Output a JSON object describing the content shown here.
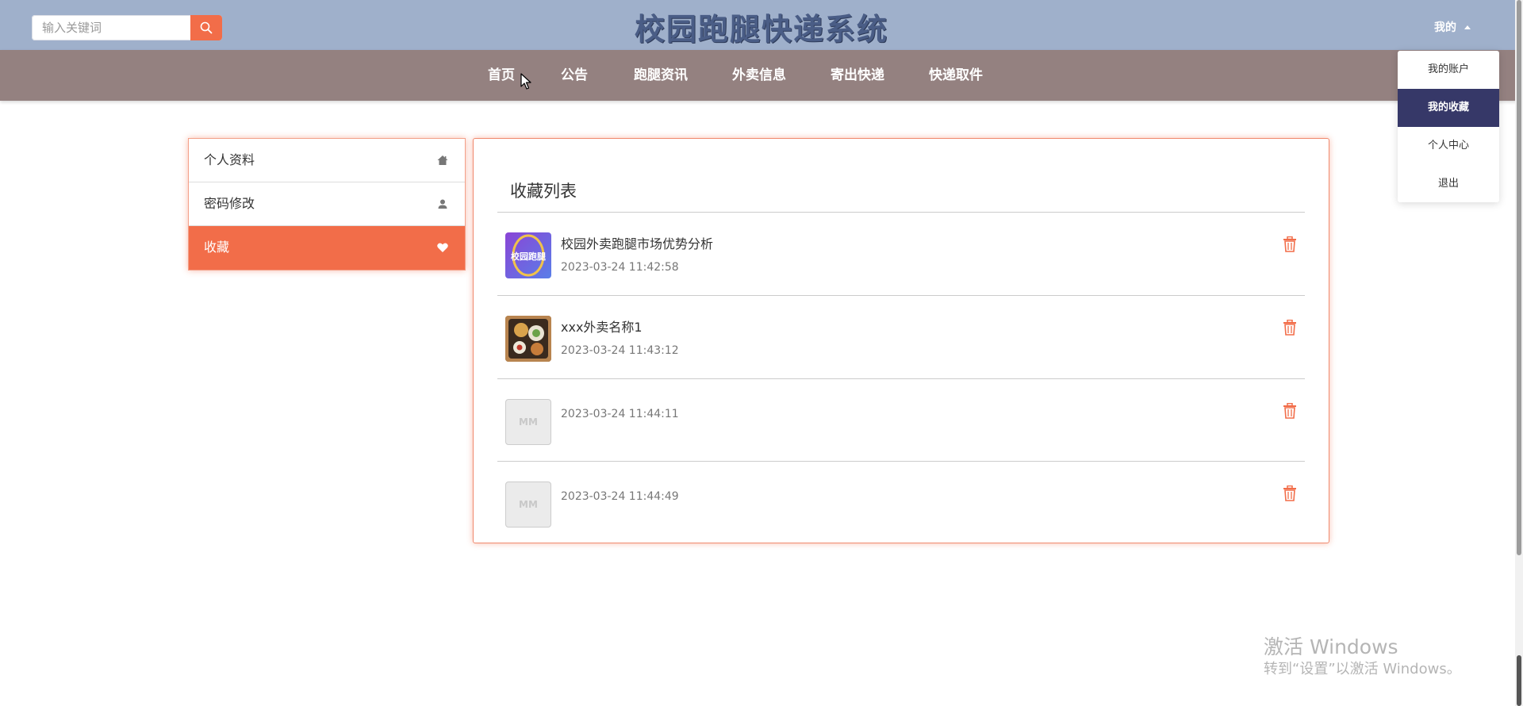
{
  "header": {
    "site_title": "校园跑腿快递系统",
    "search": {
      "placeholder": "输入关键词",
      "value": ""
    },
    "user_menu_label": "我的",
    "user_dropdown": [
      {
        "label": "我的账户",
        "active": false
      },
      {
        "label": "我的收藏",
        "active": true
      },
      {
        "label": "个人中心",
        "active": false
      },
      {
        "label": "退出",
        "active": false
      }
    ]
  },
  "nav": {
    "items": [
      {
        "label": "首页"
      },
      {
        "label": "公告"
      },
      {
        "label": "跑腿资讯"
      },
      {
        "label": "外卖信息"
      },
      {
        "label": "寄出快递"
      },
      {
        "label": "快递取件"
      }
    ]
  },
  "sidebar": {
    "items": [
      {
        "label": "个人资料",
        "icon": "home-icon",
        "active": false
      },
      {
        "label": "密码修改",
        "icon": "user-icon",
        "active": false
      },
      {
        "label": "收藏",
        "icon": "heart-icon",
        "active": true
      }
    ]
  },
  "favorites": {
    "title": "收藏列表",
    "items": [
      {
        "title": "校园外卖跑腿市场优势分析",
        "time": "2023-03-24 11:42:58",
        "thumb": "image",
        "thumb_text": "校园跑腿"
      },
      {
        "title": "xxx外卖名称1",
        "time": "2023-03-24 11:43:12",
        "thumb": "food-image"
      },
      {
        "title": "",
        "time": "2023-03-24 11:44:11",
        "thumb": "placeholder",
        "thumb_text": "MM"
      },
      {
        "title": "",
        "time": "2023-03-24 11:44:49",
        "thumb": "placeholder",
        "thumb_text": "MM"
      }
    ]
  },
  "watermark": {
    "line1": "激活 Windows",
    "line2": "转到“设置”以激活 Windows。"
  },
  "colors": {
    "topbar": "#9fb0cb",
    "navbar": "#948180",
    "accent": "#f26d49",
    "dropdown_active": "#363868"
  }
}
